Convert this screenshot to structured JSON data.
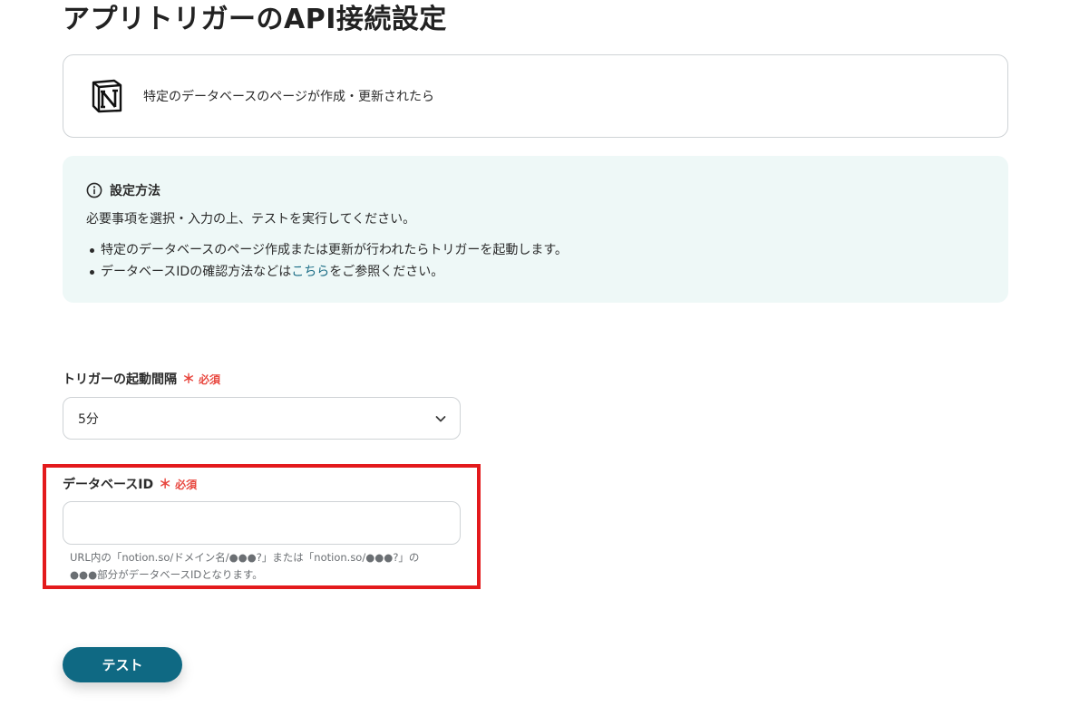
{
  "page": {
    "title": "アプリトリガーのAPI接続設定"
  },
  "app_card": {
    "logo_icon": "notion-logo-icon",
    "trigger_description": "特定のデータベースのページが作成・更新されたら"
  },
  "info_box": {
    "icon": "info-circle-icon",
    "title": "設定方法",
    "description": "必要事項を選択・入力の上、テストを実行してください。",
    "items": [
      {
        "text": "特定のデータベースのページ作成または更新が行われたらトリガーを起動します。"
      },
      {
        "prefix": "データベースIDの確認方法などは",
        "link": "こちら",
        "suffix": "をご参照ください。"
      }
    ],
    "link_color": "#1b6d86"
  },
  "fields": {
    "interval": {
      "label": "トリガーの起動間隔",
      "required_mark": "＊",
      "required_text": "必須",
      "value": "5分",
      "chevron_icon": "chevron-down-icon"
    },
    "database_id": {
      "label": "データベースID",
      "required_mark": "＊",
      "required_text": "必須",
      "value": "",
      "help_line1": "URL内の「notion.so/ドメイン名/●●●?」または「notion.so/●●●?」の",
      "help_line2": "●●●部分がデータベースIDとなります。"
    }
  },
  "actions": {
    "test_label": "テスト"
  },
  "colors": {
    "required": "#e8473f",
    "primary_button": "#0f6983",
    "info_background": "#eef8f7",
    "highlight_frame": "#e31a1c"
  }
}
